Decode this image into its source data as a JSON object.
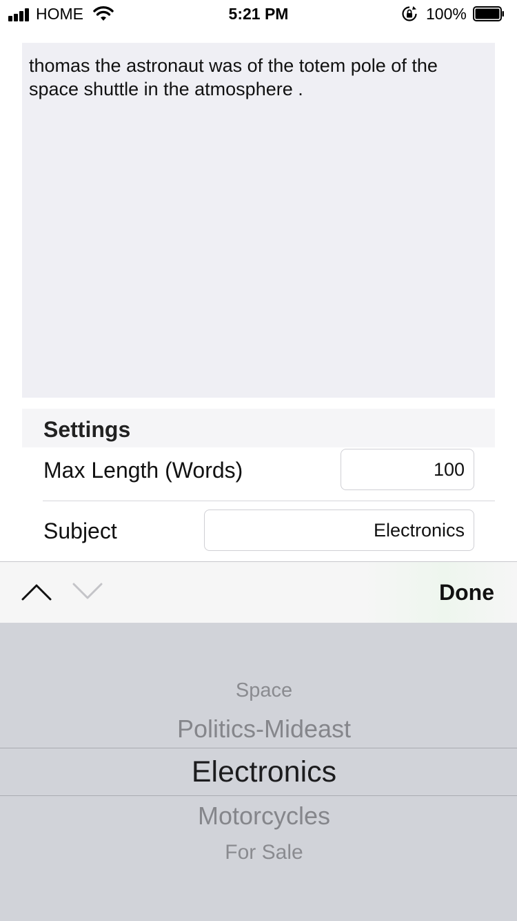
{
  "status_bar": {
    "carrier": "HOME",
    "time": "5:21 PM",
    "battery_percent": "100%"
  },
  "text_area": {
    "content": "thomas the astronaut was of the totem pole of the space shuttle in the atmosphere ."
  },
  "settings": {
    "header": "Settings",
    "max_length": {
      "label": "Max Length (Words)",
      "value": "100"
    },
    "subject": {
      "label": "Subject",
      "value": "Electronics"
    }
  },
  "toolbar": {
    "done_label": "Done",
    "icons": [
      "chevron-up-icon",
      "chevron-down-icon"
    ]
  },
  "picker": {
    "options": [
      "Space",
      "Politics-Mideast",
      "Electronics",
      "Motorcycles",
      "For Sale"
    ],
    "selected": "Electronics"
  }
}
